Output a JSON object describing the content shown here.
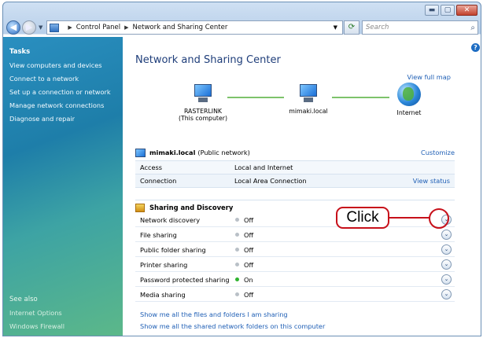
{
  "window": {
    "caption_buttons": [
      "minimize",
      "maximize",
      "close"
    ]
  },
  "address": {
    "crumbs": [
      "Control Panel",
      "Network and Sharing Center"
    ],
    "search_placeholder": "Search"
  },
  "sidebar": {
    "tasks_heading": "Tasks",
    "tasks": [
      "View computers and devices",
      "Connect to a network",
      "Set up a connection or network",
      "Manage network connections",
      "Diagnose and repair"
    ],
    "see_also_heading": "See also",
    "see_also": [
      "Internet Options",
      "Windows Firewall"
    ]
  },
  "main": {
    "title": "Network and Sharing Center",
    "view_full_map": "View full map",
    "map": {
      "nodes": [
        {
          "label": "RASTERLINK",
          "sub": "(This computer)"
        },
        {
          "label": "mimaki.local",
          "sub": ""
        },
        {
          "label": "Internet",
          "sub": ""
        }
      ]
    },
    "network": {
      "name": "mimaki.local",
      "type": "(Public network)",
      "customize": "Customize",
      "rows": [
        {
          "key": "Access",
          "value": "Local and Internet",
          "link": ""
        },
        {
          "key": "Connection",
          "value": "Local Area Connection",
          "link": "View status"
        }
      ]
    },
    "sharing": {
      "heading": "Sharing and Discovery",
      "rows": [
        {
          "label": "Network discovery",
          "state": "Off",
          "on": false
        },
        {
          "label": "File sharing",
          "state": "Off",
          "on": false
        },
        {
          "label": "Public folder sharing",
          "state": "Off",
          "on": false
        },
        {
          "label": "Printer sharing",
          "state": "Off",
          "on": false
        },
        {
          "label": "Password protected sharing",
          "state": "On",
          "on": true
        },
        {
          "label": "Media sharing",
          "state": "Off",
          "on": false
        }
      ]
    },
    "bottom_links": [
      "Show me all the files and folders I am sharing",
      "Show me all the shared network folders on this computer"
    ]
  },
  "annotation": {
    "callout_text": "Click",
    "callout_color": "#c7101a"
  },
  "colors": {
    "link": "#1f5fb5",
    "title": "#1f3e7a",
    "status_on": "#2fb32f",
    "status_off": "#b9c0c7"
  }
}
